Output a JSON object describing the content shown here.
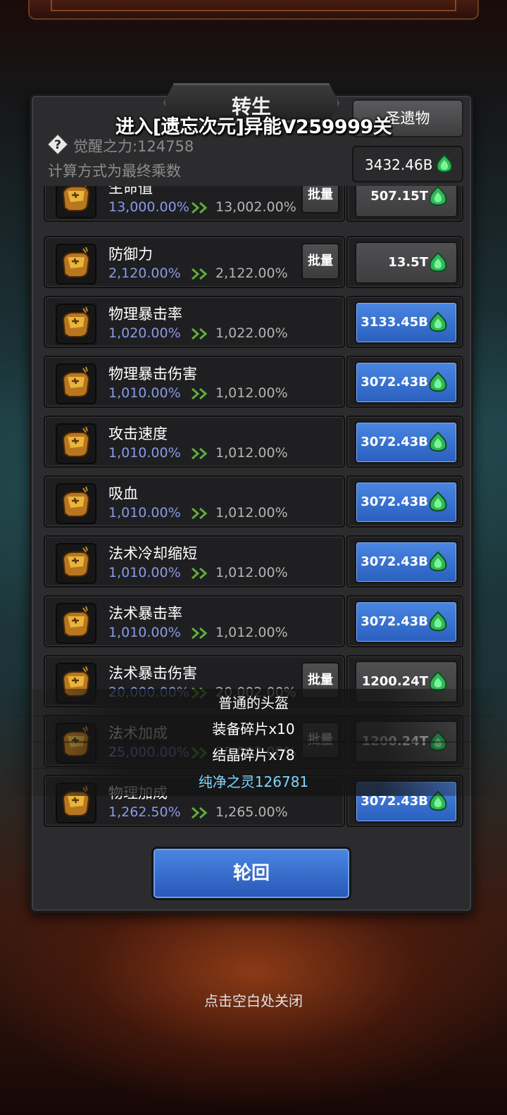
{
  "header": {
    "title": "转生",
    "entry_banner": "进入[遗忘次元]异能V259999关",
    "relic_button": "圣遗物",
    "currency_value": "3432.46B",
    "awaken_power": "觉醒之力:124758",
    "calc_note": "计算方式为最终乘数"
  },
  "batch_label": "批量",
  "rows": [
    {
      "label": "生命值",
      "current": "13,000.00%",
      "next": "13,002.00%",
      "cost": "507.15T",
      "batch": true,
      "style": "gray"
    },
    {
      "label": "防御力",
      "current": "2,120.00%",
      "next": "2,122.00%",
      "cost": "13.5T",
      "batch": true,
      "style": "gray"
    },
    {
      "label": "物理暴击率",
      "current": "1,020.00%",
      "next": "1,022.00%",
      "cost": "3133.45B",
      "batch": false,
      "style": "blue"
    },
    {
      "label": "物理暴击伤害",
      "current": "1,010.00%",
      "next": "1,012.00%",
      "cost": "3072.43B",
      "batch": false,
      "style": "blue"
    },
    {
      "label": "攻击速度",
      "current": "1,010.00%",
      "next": "1,012.00%",
      "cost": "3072.43B",
      "batch": false,
      "style": "blue"
    },
    {
      "label": "吸血",
      "current": "1,010.00%",
      "next": "1,012.00%",
      "cost": "3072.43B",
      "batch": false,
      "style": "blue"
    },
    {
      "label": "法术冷却缩短",
      "current": "1,010.00%",
      "next": "1,012.00%",
      "cost": "3072.43B",
      "batch": false,
      "style": "blue"
    },
    {
      "label": "法术暴击率",
      "current": "1,010.00%",
      "next": "1,012.00%",
      "cost": "3072.43B",
      "batch": false,
      "style": "blue"
    },
    {
      "label": "法术暴击伤害",
      "current": "20,000.00%",
      "next": "20,002.00%",
      "cost": "1200.24T",
      "batch": true,
      "style": "gray"
    },
    {
      "label": "法术加成",
      "current": "25,000.00%",
      "next": "25,002.00%",
      "cost": "1200.24T",
      "batch": true,
      "style": "gray"
    },
    {
      "label": "物理加成",
      "current": "1,262.50%",
      "next": "1,265.00%",
      "cost": "3072.43B",
      "batch": false,
      "style": "blue"
    }
  ],
  "toasts": [
    "普通的头盔",
    "装备碎片x10",
    "结晶碎片x78",
    "纯净之灵126781"
  ],
  "reincarnate_button": "轮回",
  "close_hint": "点击空白处关闭",
  "colors": {
    "blue_button": "#3b74d4",
    "percent_current": "#8a9ae8",
    "green_gem": "#3fd36a",
    "cyan_text": "#7fd8ff"
  }
}
